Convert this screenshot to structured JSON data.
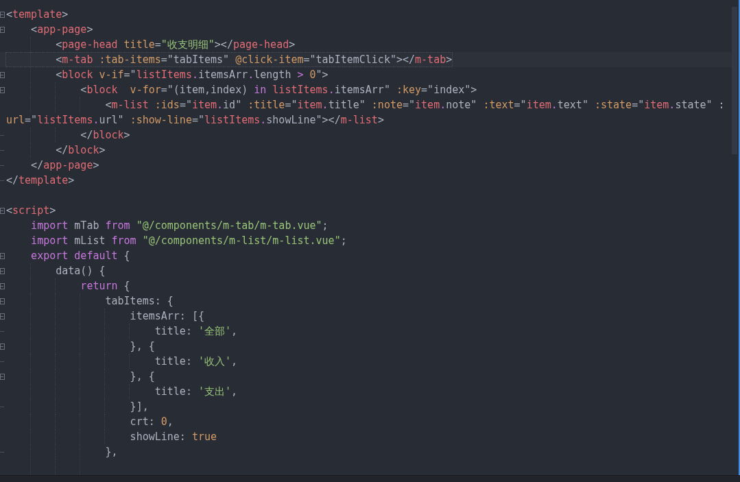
{
  "editor": {
    "lines": [
      {
        "collapsible": true,
        "block_end": false,
        "current": false,
        "gap_before": false,
        "tokens": [
          {
            "text": "<",
            "kind": "punct"
          },
          {
            "text": "template",
            "kind": "tag"
          },
          {
            "text": ">",
            "kind": "punct"
          }
        ]
      },
      {
        "collapsible": true,
        "block_end": false,
        "current": false,
        "gap_before": false,
        "tokens": [
          {
            "text": "    <",
            "kind": "punct"
          },
          {
            "text": "app-page",
            "kind": "tag"
          },
          {
            "text": ">",
            "kind": "punct"
          }
        ]
      },
      {
        "collapsible": false,
        "block_end": false,
        "current": false,
        "gap_before": false,
        "tokens": [
          {
            "text": "        <",
            "kind": "punct"
          },
          {
            "text": "page-head",
            "kind": "tag"
          },
          {
            "text": " title",
            "kind": "attr"
          },
          {
            "text": "=",
            "kind": "punct"
          },
          {
            "text": "\"收支明细\"",
            "kind": "string"
          },
          {
            "text": "></",
            "kind": "punct"
          },
          {
            "text": "page-head",
            "kind": "tag"
          },
          {
            "text": ">",
            "kind": "punct"
          }
        ]
      },
      {
        "collapsible": false,
        "block_end": false,
        "current": true,
        "gap_before": false,
        "tokens": [
          {
            "text": "        <",
            "kind": "punct"
          },
          {
            "text": "m-tab",
            "kind": "tag"
          },
          {
            "text": " :tab-items",
            "kind": "attr"
          },
          {
            "text": "=\"tabItems\" ",
            "kind": "punct"
          },
          {
            "text": "@click-item",
            "kind": "attr"
          },
          {
            "text": "=\"tabItemClick\"></",
            "kind": "punct"
          },
          {
            "text": "m-tab",
            "kind": "tag"
          },
          {
            "text": ">",
            "kind": "punct"
          }
        ]
      },
      {
        "collapsible": true,
        "block_end": false,
        "current": false,
        "gap_before": false,
        "tokens": [
          {
            "text": "        <",
            "kind": "punct"
          },
          {
            "text": "block",
            "kind": "tag"
          },
          {
            "text": " v-if",
            "kind": "attr"
          },
          {
            "text": "=\"",
            "kind": "punct"
          },
          {
            "text": "listItems",
            "kind": "tag"
          },
          {
            "text": ".",
            "kind": "keyword"
          },
          {
            "text": "itemsArr",
            "kind": "punct"
          },
          {
            "text": ".",
            "kind": "keyword"
          },
          {
            "text": "length ",
            "kind": "punct"
          },
          {
            "text": ">",
            "kind": "keyword"
          },
          {
            "text": " 0",
            "kind": "number"
          },
          {
            "text": "\">",
            "kind": "punct"
          }
        ]
      },
      {
        "collapsible": true,
        "block_end": false,
        "current": false,
        "gap_before": false,
        "tokens": [
          {
            "text": "            <",
            "kind": "punct"
          },
          {
            "text": "block",
            "kind": "tag"
          },
          {
            "text": "  v-for",
            "kind": "attr"
          },
          {
            "text": "=\"(item,index)",
            "kind": "punct"
          },
          {
            "text": " in",
            "kind": "keyword"
          },
          {
            "text": " listItems",
            "kind": "tag"
          },
          {
            "text": ".",
            "kind": "keyword"
          },
          {
            "text": "itemsArr\" ",
            "kind": "punct"
          },
          {
            "text": ":key",
            "kind": "attr"
          },
          {
            "text": "=\"index\">",
            "kind": "punct"
          }
        ]
      },
      {
        "collapsible": false,
        "block_end": false,
        "current": false,
        "gap_before": false,
        "tokens": [
          {
            "text": "                <",
            "kind": "punct"
          },
          {
            "text": "m-list",
            "kind": "tag"
          },
          {
            "text": " :ids",
            "kind": "attr"
          },
          {
            "text": "=\"",
            "kind": "punct"
          },
          {
            "text": "item",
            "kind": "tag"
          },
          {
            "text": ".",
            "kind": "keyword"
          },
          {
            "text": "id\" ",
            "kind": "punct"
          },
          {
            "text": ":title",
            "kind": "attr"
          },
          {
            "text": "=\"",
            "kind": "punct"
          },
          {
            "text": "item",
            "kind": "tag"
          },
          {
            "text": ".",
            "kind": "keyword"
          },
          {
            "text": "title\" ",
            "kind": "punct"
          },
          {
            "text": ":note",
            "kind": "attr"
          },
          {
            "text": "=\"",
            "kind": "punct"
          },
          {
            "text": "item",
            "kind": "tag"
          },
          {
            "text": ".",
            "kind": "keyword"
          },
          {
            "text": "note\" ",
            "kind": "punct"
          },
          {
            "text": ":text",
            "kind": "attr"
          },
          {
            "text": "=\"",
            "kind": "punct"
          },
          {
            "text": "item",
            "kind": "tag"
          },
          {
            "text": ".",
            "kind": "keyword"
          },
          {
            "text": "text\" ",
            "kind": "punct"
          },
          {
            "text": ":state",
            "kind": "attr"
          },
          {
            "text": "=\"",
            "kind": "punct"
          },
          {
            "text": "item",
            "kind": "tag"
          },
          {
            "text": ".",
            "kind": "keyword"
          },
          {
            "text": "state\" :",
            "kind": "punct"
          }
        ]
      },
      {
        "collapsible": false,
        "block_end": false,
        "current": false,
        "gap_before": false,
        "tokens": [
          {
            "text": "url",
            "kind": "attr"
          },
          {
            "text": "=\"",
            "kind": "punct"
          },
          {
            "text": "listItems",
            "kind": "tag"
          },
          {
            "text": ".",
            "kind": "keyword"
          },
          {
            "text": "url\" ",
            "kind": "punct"
          },
          {
            "text": ":show-line",
            "kind": "attr"
          },
          {
            "text": "=\"",
            "kind": "punct"
          },
          {
            "text": "listItems",
            "kind": "tag"
          },
          {
            "text": ".",
            "kind": "keyword"
          },
          {
            "text": "showLine\"></",
            "kind": "punct"
          },
          {
            "text": "m-list",
            "kind": "tag"
          },
          {
            "text": ">",
            "kind": "punct"
          }
        ]
      },
      {
        "collapsible": false,
        "block_end": true,
        "current": false,
        "gap_before": false,
        "tokens": [
          {
            "text": "            </",
            "kind": "punct"
          },
          {
            "text": "block",
            "kind": "tag"
          },
          {
            "text": ">",
            "kind": "punct"
          }
        ]
      },
      {
        "collapsible": false,
        "block_end": true,
        "current": false,
        "gap_before": false,
        "tokens": [
          {
            "text": "        </",
            "kind": "punct"
          },
          {
            "text": "block",
            "kind": "tag"
          },
          {
            "text": ">",
            "kind": "punct"
          }
        ]
      },
      {
        "collapsible": false,
        "block_end": true,
        "current": false,
        "gap_before": false,
        "tokens": [
          {
            "text": "    </",
            "kind": "punct"
          },
          {
            "text": "app-page",
            "kind": "tag"
          },
          {
            "text": ">",
            "kind": "punct"
          }
        ]
      },
      {
        "collapsible": false,
        "block_end": true,
        "current": false,
        "gap_before": false,
        "tokens": [
          {
            "text": "</",
            "kind": "punct"
          },
          {
            "text": "template",
            "kind": "tag"
          },
          {
            "text": ">",
            "kind": "punct"
          }
        ]
      },
      {
        "collapsible": true,
        "block_end": false,
        "current": false,
        "gap_before": true,
        "tokens": [
          {
            "text": "<",
            "kind": "punct"
          },
          {
            "text": "script",
            "kind": "tag"
          },
          {
            "text": ">",
            "kind": "punct"
          }
        ]
      },
      {
        "collapsible": false,
        "block_end": false,
        "current": false,
        "gap_before": false,
        "tokens": [
          {
            "text": "    import",
            "kind": "keyword"
          },
          {
            "text": " mTab ",
            "kind": "punct"
          },
          {
            "text": "from",
            "kind": "keyword"
          },
          {
            "text": " \"@/components/m-tab/m-tab.vue\"",
            "kind": "string"
          },
          {
            "text": ";",
            "kind": "punct"
          }
        ]
      },
      {
        "collapsible": false,
        "block_end": false,
        "current": false,
        "gap_before": false,
        "tokens": [
          {
            "text": "    import",
            "kind": "keyword"
          },
          {
            "text": " mList ",
            "kind": "punct"
          },
          {
            "text": "from",
            "kind": "keyword"
          },
          {
            "text": " \"@/components/m-list/m-list.vue\"",
            "kind": "string"
          },
          {
            "text": ";",
            "kind": "punct"
          }
        ]
      },
      {
        "collapsible": true,
        "block_end": false,
        "current": false,
        "gap_before": false,
        "tokens": [
          {
            "text": "    export default",
            "kind": "keyword"
          },
          {
            "text": " {",
            "kind": "punct"
          }
        ]
      },
      {
        "collapsible": true,
        "block_end": false,
        "current": false,
        "gap_before": false,
        "tokens": [
          {
            "text": "        data() {",
            "kind": "punct"
          }
        ]
      },
      {
        "collapsible": true,
        "block_end": false,
        "current": false,
        "gap_before": false,
        "tokens": [
          {
            "text": "            return",
            "kind": "keyword"
          },
          {
            "text": " {",
            "kind": "punct"
          }
        ]
      },
      {
        "collapsible": true,
        "block_end": false,
        "current": false,
        "gap_before": false,
        "tokens": [
          {
            "text": "                tabItems: {",
            "kind": "punct"
          }
        ]
      },
      {
        "collapsible": true,
        "block_end": false,
        "current": false,
        "gap_before": false,
        "tokens": [
          {
            "text": "                    itemsArr: [{",
            "kind": "punct"
          }
        ]
      },
      {
        "collapsible": false,
        "block_end": true,
        "current": false,
        "gap_before": false,
        "tokens": [
          {
            "text": "                        title: ",
            "kind": "punct"
          },
          {
            "text": "'全部'",
            "kind": "string"
          },
          {
            "text": ",",
            "kind": "punct"
          }
        ]
      },
      {
        "collapsible": true,
        "block_end": false,
        "current": false,
        "gap_before": false,
        "tokens": [
          {
            "text": "                    }, {",
            "kind": "punct"
          }
        ]
      },
      {
        "collapsible": false,
        "block_end": true,
        "current": false,
        "gap_before": false,
        "tokens": [
          {
            "text": "                        title: ",
            "kind": "punct"
          },
          {
            "text": "'收入'",
            "kind": "string"
          },
          {
            "text": ",",
            "kind": "punct"
          }
        ]
      },
      {
        "collapsible": true,
        "block_end": false,
        "current": false,
        "gap_before": false,
        "tokens": [
          {
            "text": "                    }, {",
            "kind": "punct"
          }
        ]
      },
      {
        "collapsible": false,
        "block_end": false,
        "current": false,
        "gap_before": false,
        "tokens": [
          {
            "text": "                        title: ",
            "kind": "punct"
          },
          {
            "text": "'支出'",
            "kind": "string"
          },
          {
            "text": ",",
            "kind": "punct"
          }
        ]
      },
      {
        "collapsible": false,
        "block_end": true,
        "current": false,
        "gap_before": false,
        "tokens": [
          {
            "text": "                    }],",
            "kind": "punct"
          }
        ]
      },
      {
        "collapsible": false,
        "block_end": false,
        "current": false,
        "gap_before": false,
        "tokens": [
          {
            "text": "                    crt: ",
            "kind": "punct"
          },
          {
            "text": "0",
            "kind": "number"
          },
          {
            "text": ",",
            "kind": "punct"
          }
        ]
      },
      {
        "collapsible": false,
        "block_end": false,
        "current": false,
        "gap_before": false,
        "tokens": [
          {
            "text": "                    showLine: ",
            "kind": "punct"
          },
          {
            "text": "true",
            "kind": "number"
          }
        ]
      },
      {
        "collapsible": false,
        "block_end": true,
        "current": false,
        "gap_before": false,
        "tokens": [
          {
            "text": "                },",
            "kind": "punct"
          }
        ]
      }
    ]
  }
}
